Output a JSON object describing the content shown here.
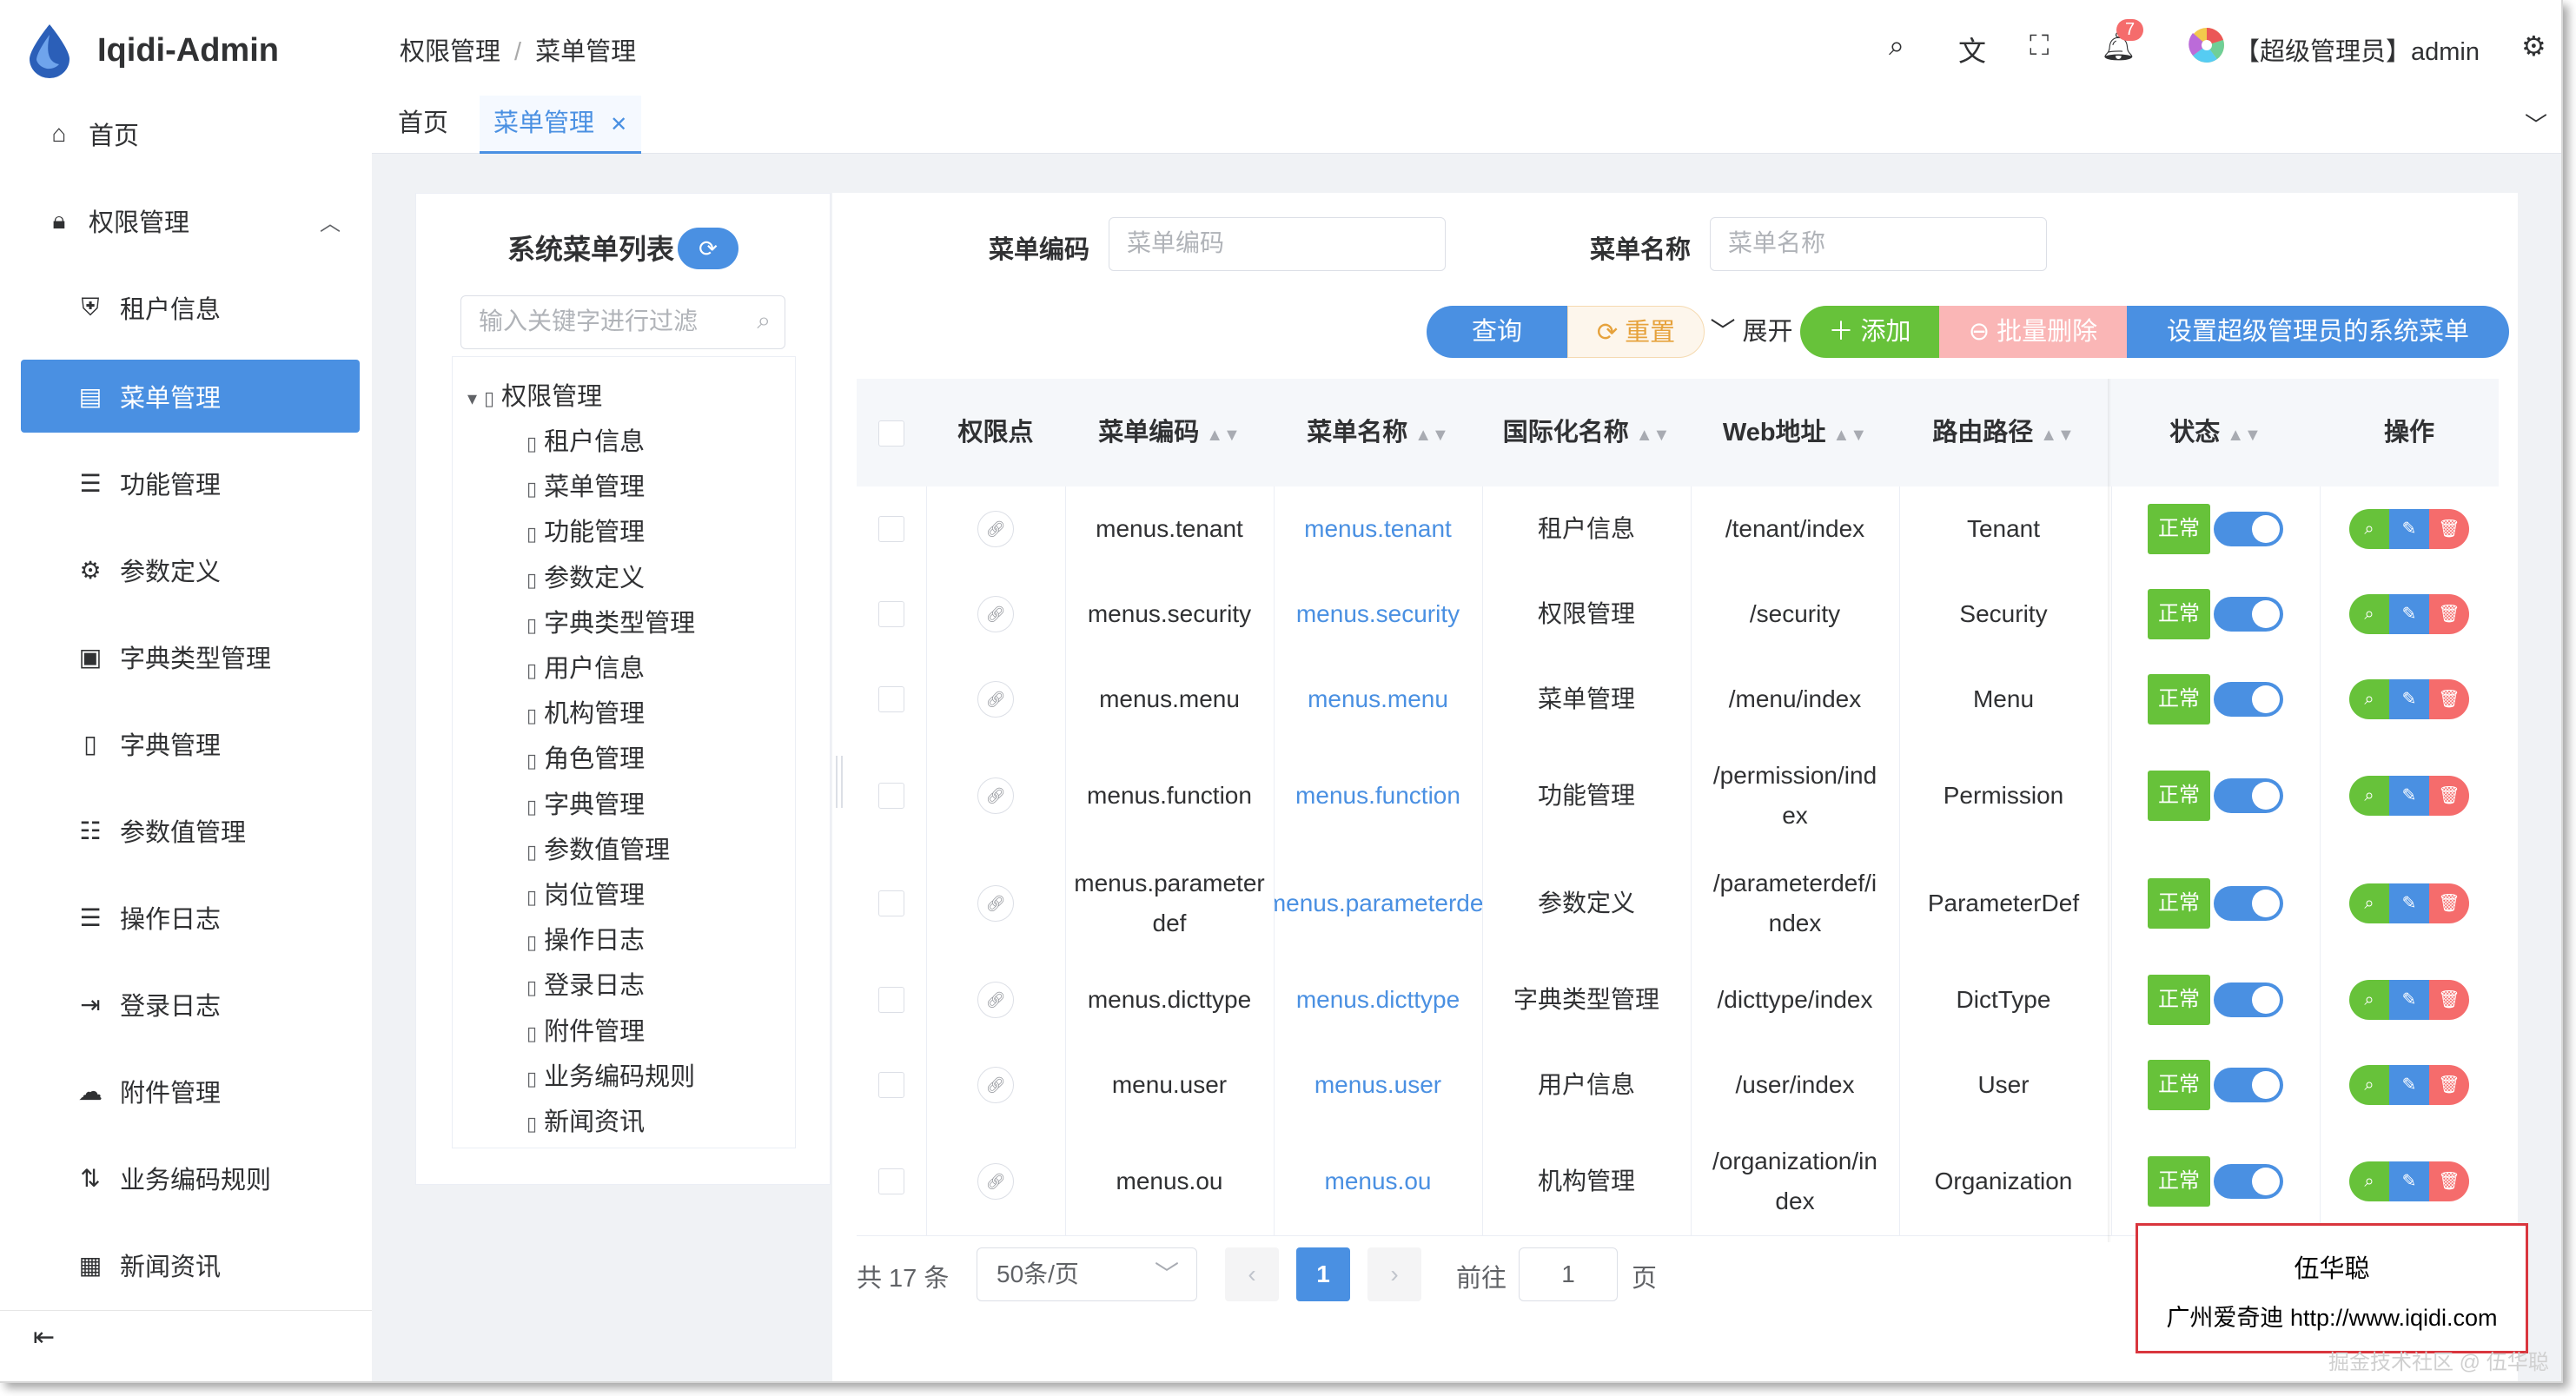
{
  "app": {
    "title": "Iqidi-Admin"
  },
  "sidebar": {
    "items": [
      {
        "label": "首页",
        "icon": "home-icon"
      },
      {
        "label": "权限管理",
        "icon": "lock-icon"
      },
      {
        "label": "租户信息",
        "icon": "shield-icon"
      },
      {
        "label": "菜单管理",
        "icon": "menu-icon"
      },
      {
        "label": "功能管理",
        "icon": "list-icon"
      },
      {
        "label": "参数定义",
        "icon": "gear-icon"
      },
      {
        "label": "字典类型管理",
        "icon": "book-icon"
      },
      {
        "label": "字典管理",
        "icon": "notebook-icon"
      },
      {
        "label": "参数值管理",
        "icon": "filter-list-icon"
      },
      {
        "label": "操作日志",
        "icon": "list-icon"
      },
      {
        "label": "登录日志",
        "icon": "login-icon"
      },
      {
        "label": "附件管理",
        "icon": "cloud-upload-icon"
      },
      {
        "label": "业务编码规则",
        "icon": "sort-icon"
      },
      {
        "label": "新闻资讯",
        "icon": "news-icon"
      }
    ]
  },
  "header": {
    "breadcrumb": [
      "权限管理",
      "菜单管理"
    ],
    "notification_count": "7",
    "user": "【超级管理员】admin"
  },
  "tabs": [
    {
      "label": "首页"
    },
    {
      "label": "菜单管理"
    }
  ],
  "tree": {
    "title": "系统菜单列表",
    "filter_placeholder": "输入关键字进行过滤",
    "root": "权限管理",
    "children": [
      "租户信息",
      "菜单管理",
      "功能管理",
      "参数定义",
      "字典类型管理",
      "用户信息",
      "机构管理",
      "角色管理",
      "字典管理",
      "参数值管理",
      "岗位管理",
      "操作日志",
      "登录日志",
      "附件管理",
      "业务编码规则",
      "新闻资讯"
    ]
  },
  "search": {
    "code_label": "菜单编码",
    "code_placeholder": "菜单编码",
    "name_label": "菜单名称",
    "name_placeholder": "菜单名称"
  },
  "toolbar": {
    "query": "查询",
    "reset": "重置",
    "expand": "展开",
    "add": "添加",
    "batch_delete": "批量删除",
    "set_super": "设置超级管理员的系统菜单"
  },
  "table": {
    "columns": [
      "权限点",
      "菜单编码",
      "菜单名称",
      "国际化名称",
      "Web地址",
      "路由路径",
      "状态",
      "操作"
    ],
    "rows": [
      {
        "code": "menus.tenant",
        "name": "menus.tenant",
        "i18n": "租户信息",
        "web": "/tenant/index",
        "route": "Tenant",
        "status": "正常"
      },
      {
        "code": "menus.security",
        "name": "menus.security",
        "i18n": "权限管理",
        "web": "/security",
        "route": "Security",
        "status": "正常"
      },
      {
        "code": "menus.menu",
        "name": "menus.menu",
        "i18n": "菜单管理",
        "web": "/menu/index",
        "route": "Menu",
        "status": "正常"
      },
      {
        "code": "menus.function",
        "name": "menus.function",
        "i18n": "功能管理",
        "web": "/permission/index",
        "route": "Permission",
        "status": "正常"
      },
      {
        "code": "menus.parameterdef",
        "name": "menus.parameterdef",
        "i18n": "参数定义",
        "web": "/parameterdef/index",
        "route": "ParameterDef",
        "status": "正常"
      },
      {
        "code": "menus.dicttype",
        "name": "menus.dicttype",
        "i18n": "字典类型管理",
        "web": "/dicttype/index",
        "route": "DictType",
        "status": "正常"
      },
      {
        "code": "menu.user",
        "name": "menus.user",
        "i18n": "用户信息",
        "web": "/user/index",
        "route": "User",
        "status": "正常"
      },
      {
        "code": "menus.ou",
        "name": "menus.ou",
        "i18n": "机构管理",
        "web": "/organization/index",
        "route": "Organization",
        "status": "正常"
      }
    ]
  },
  "pagination": {
    "total": "共 17 条",
    "page_size": "50条/页",
    "current": "1",
    "goto_label": "前往",
    "goto_value": "1",
    "page_suffix": "页"
  },
  "watermark": {
    "name": "伍华聪",
    "company": "广州爱奇迪",
    "url": "http://www.iqidi.com",
    "credit": "掘金技术社区 @ 伍华聪"
  },
  "colors": {
    "primary": "#4a90e2",
    "success": "#67c23a",
    "danger": "#f56c6c",
    "warning": "#e6a23c"
  }
}
